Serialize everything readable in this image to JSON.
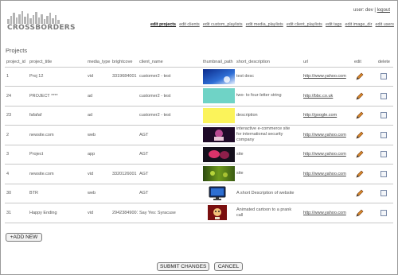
{
  "header": {
    "logo_text": "CROSSBORDERS",
    "user_label": "user: dev",
    "logout_label": "logout"
  },
  "nav": {
    "items": [
      "edit projects",
      "edit clients",
      "edit custom_playlists",
      "edit media_playlists",
      "edit client_playlists",
      "edit tags",
      "edit image_dir",
      "edit users"
    ],
    "active": "edit projects"
  },
  "main": {
    "title": "Projects",
    "columns": [
      "project_id",
      "project_title",
      "media_type",
      "brightcove",
      "client_name",
      "thumbnail_path",
      "short_description",
      "url",
      "edit",
      "delete"
    ],
    "rows": [
      {
        "id": "1",
        "title": "Proj 12",
        "media": "vid",
        "brightcove": "3319684001",
        "client": "customer2 - test",
        "desc": "test desc",
        "url": "http://www.yahoo.com"
      },
      {
        "id": "24",
        "title": "PROJECT ****",
        "media": "ad",
        "brightcove": "",
        "client": "customer2 - test",
        "desc": "two- to four-letter string",
        "url": "http://bbc.co.uk"
      },
      {
        "id": "23",
        "title": "fafafaf",
        "media": "ad",
        "brightcove": "",
        "client": "customer2 - test",
        "desc": "description",
        "url": "http://google.com"
      },
      {
        "id": "2",
        "title": "newsite.com",
        "media": "web",
        "brightcove": "",
        "client": "AGT",
        "desc": "interactive e-commerce site for international security company",
        "url": "http://www.yahoo.com"
      },
      {
        "id": "3",
        "title": "Project",
        "media": "app",
        "brightcove": "",
        "client": "AGT",
        "desc": "site",
        "url": "http://www.yahoo.com"
      },
      {
        "id": "4",
        "title": "newsite.com",
        "media": "vid",
        "brightcove": "3320126001",
        "client": "AGT",
        "desc": "site",
        "url": "http://www.yahoo.com"
      },
      {
        "id": "30",
        "title": "BTR",
        "media": "web",
        "brightcove": "",
        "client": "AGT",
        "desc": "A short Description of website",
        "url": ""
      },
      {
        "id": "31",
        "title": "Happy Ending",
        "media": "vid",
        "brightcove": "29423849001",
        "client": "Say Yes: Syracuse",
        "desc": "Animated cartoon to a prank call",
        "url": "http://www.yahoo.com"
      }
    ]
  },
  "buttons": {
    "add_new": "+ADD NEW",
    "submit": "SUBMIT CHANGES",
    "cancel": "CANCEL"
  }
}
